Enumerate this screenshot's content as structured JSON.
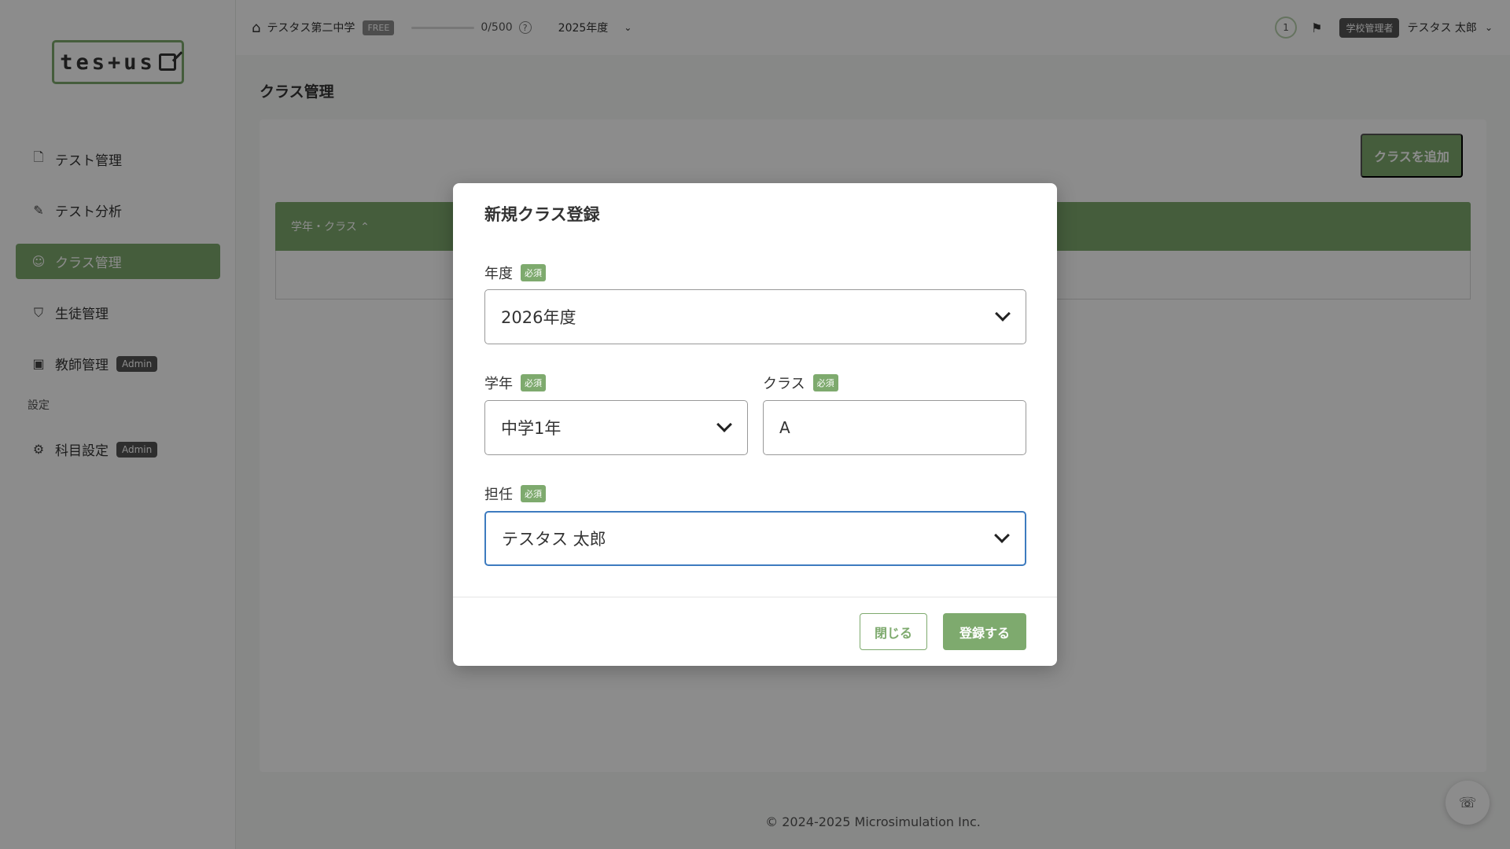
{
  "app": {
    "logo_text": "tes+us",
    "colors": {
      "accent": "#7eaa6e",
      "focus": "#3d7bbf",
      "overlay": "rgba(0,0,0,0.45)"
    }
  },
  "sidebar": {
    "items": [
      {
        "label": "テスト管理",
        "icon": "document-icon"
      },
      {
        "label": "テスト分析",
        "icon": "analysis-icon"
      },
      {
        "label": "クラス管理",
        "icon": "group-icon",
        "active": true
      },
      {
        "label": "生徒管理",
        "icon": "graduation-cap-icon"
      },
      {
        "label": "教師管理",
        "icon": "teacher-board-icon",
        "badge": "Admin"
      }
    ],
    "settings_section": "設定",
    "settings_items": [
      {
        "label": "科目設定",
        "icon": "gear-icon",
        "badge": "Admin"
      }
    ]
  },
  "topbar": {
    "school_name": "テスタス第二中学",
    "plan_badge": "FREE",
    "quota": "0/500",
    "progress_fraction": 0,
    "fiscal_year": "2025年度",
    "notification_count": "1",
    "role_badge": "学校管理者",
    "user_name": "テスタス 太郎"
  },
  "main": {
    "page_title": "クラス管理",
    "add_button": "クラスを追加",
    "table": {
      "columns": [
        "学年・クラス ⌃"
      ]
    }
  },
  "footer": {
    "copyright": "© 2024-2025 Microsimulation Inc."
  },
  "modal": {
    "title": "新規クラス登録",
    "required_badge": "必須",
    "fields": {
      "year": {
        "label": "年度",
        "value": "2026年度"
      },
      "grade": {
        "label": "学年",
        "value": "中学1年"
      },
      "class": {
        "label": "クラス",
        "value": "A"
      },
      "teacher": {
        "label": "担任",
        "value": "テスタス 太郎"
      }
    },
    "close_button": "閉じる",
    "submit_button": "登録する"
  }
}
